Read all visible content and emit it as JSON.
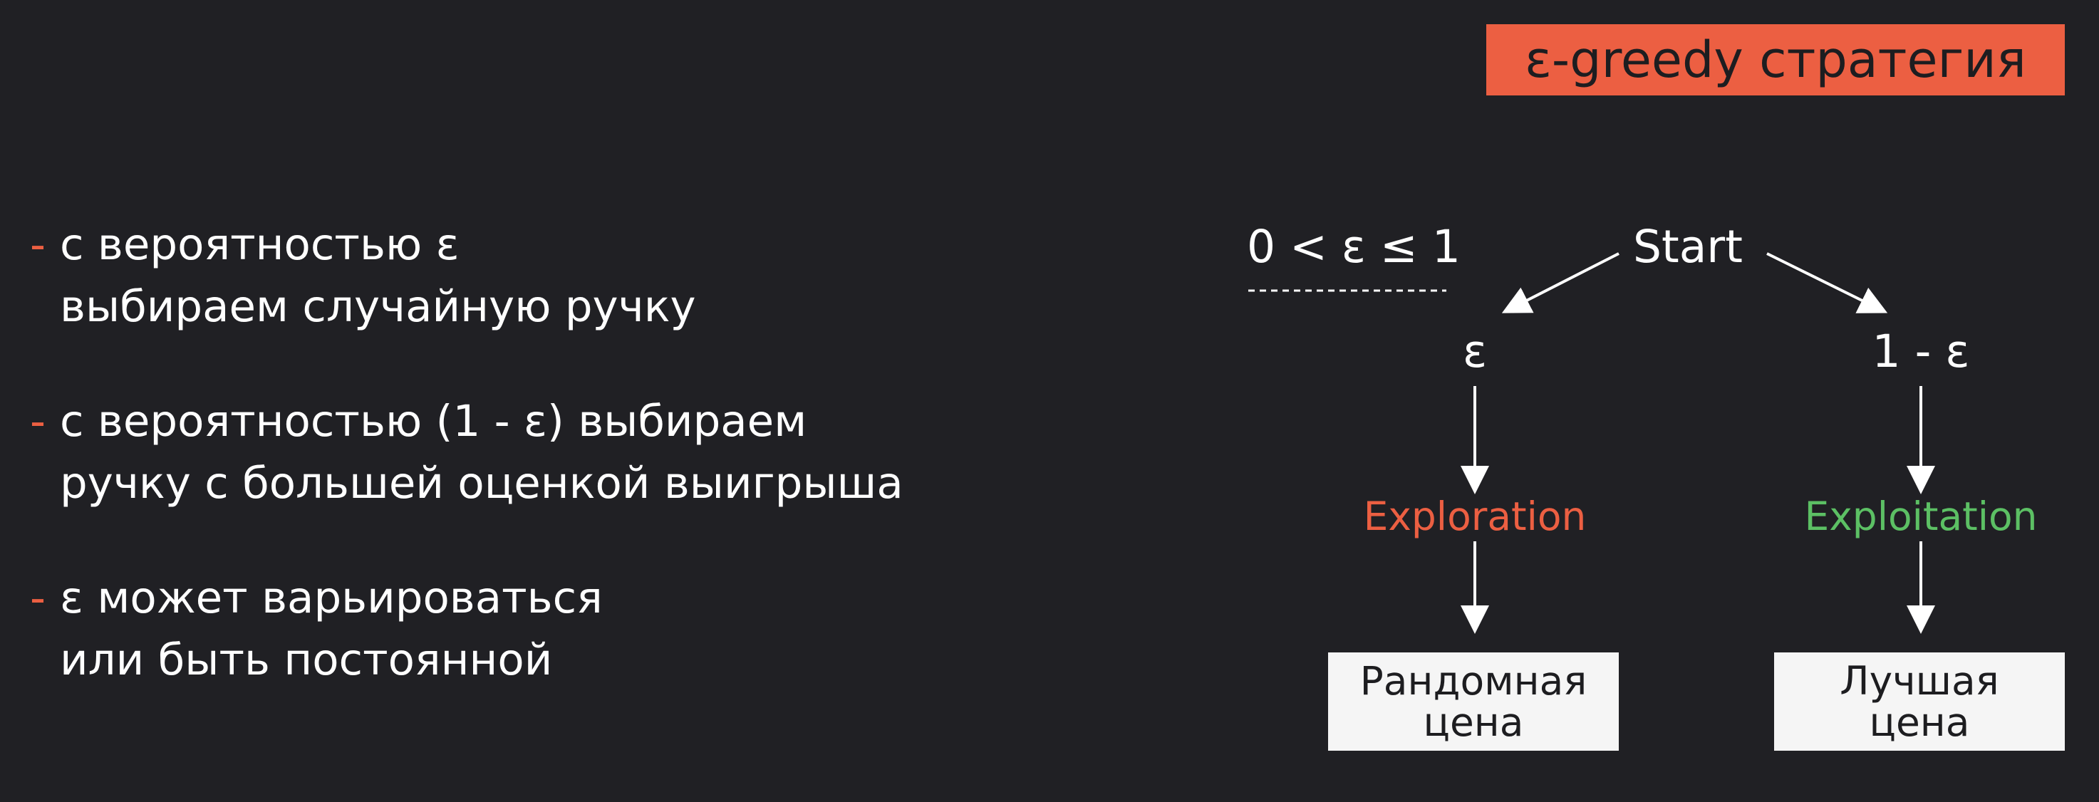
{
  "title": "ε-greedy стратегия",
  "bullets": [
    {
      "dash": "-",
      "line1": "с вероятностью ε",
      "line2": "выбираем случайную ручку"
    },
    {
      "dash": "-",
      "line1": "с вероятностью (1 - ε) выбираем",
      "line2": "ручку с большей оценкой выигрыша"
    },
    {
      "dash": "-",
      "line1": "ε может варьироваться",
      "line2": "или быть постоянной"
    }
  ],
  "diagram": {
    "constraint": "0 < ε ≤ 1",
    "start": "Start",
    "left": {
      "prob": "ε",
      "action": "Exploration",
      "result_line1": "Рандомная",
      "result_line2": "цена"
    },
    "right": {
      "prob": "1 - ε",
      "action": "Exploitation",
      "result_line1": "Лучшая",
      "result_line2": "цена"
    }
  },
  "colors": {
    "background": "#202024",
    "accent": "#ec5f42",
    "exploration": "#ec5f42",
    "exploitation": "#5cc064",
    "text": "#ffffff",
    "box": "#f5f5f5"
  }
}
